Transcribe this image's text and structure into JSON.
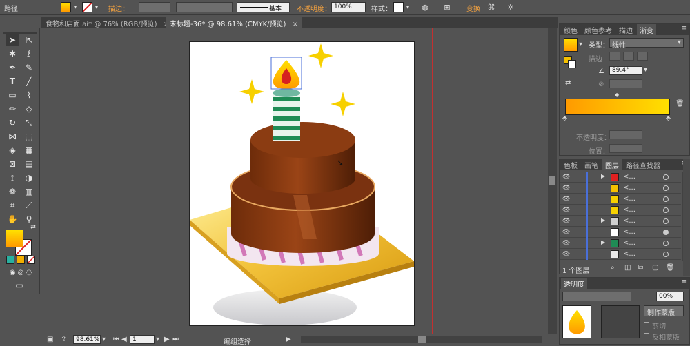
{
  "control_bar": {
    "object_type": "路径",
    "stroke_label": "描边：",
    "brush_label": "基本",
    "opacity_label": "不透明度：",
    "opacity_value": "100%",
    "style_label": "样式：",
    "transform_label": "变换"
  },
  "colors": {
    "fill_top": "#ffe000",
    "fill_bottom": "#ff9a00",
    "cake_dark": "#5a2408",
    "cake_mid": "#8b3c12",
    "plate": "#f2c23a",
    "guide": "#c23030",
    "layer_bar": "#4a6fd8"
  },
  "tabs": [
    {
      "label": "食物和店面.ai* @ 76% (RGB/预览)"
    },
    {
      "label": "未标题-36* @ 98.61% (CMYK/预览)"
    }
  ],
  "status_bar": {
    "zoom": "98.61%",
    "page": "1",
    "tool_status": "编组选择"
  },
  "gradient_panel": {
    "tabs": [
      "颜色",
      "颜色参考",
      "描边",
      "渐变"
    ],
    "type_label": "类型：",
    "type_value": "线性",
    "stroke_label": "描边",
    "angle_value": "89.4°",
    "opacity_label": "不透明度：",
    "position_label": "位置："
  },
  "layers_panel": {
    "tabs": [
      "色板",
      "画笔",
      "图层",
      "路径查找器"
    ],
    "rows": [
      {
        "name": "<...",
        "thumb": "#e02020",
        "expandable": true
      },
      {
        "name": "<...",
        "thumb": "#f5c000",
        "expandable": false
      },
      {
        "name": "<...",
        "thumb": "#f5d000",
        "expandable": false
      },
      {
        "name": "<...",
        "thumb": "#f5d000",
        "expandable": false
      },
      {
        "name": "<...",
        "thumb": "#cfcfcf",
        "expandable": true
      },
      {
        "name": "<...",
        "thumb": "#ffffff",
        "expandable": false
      },
      {
        "name": "<...",
        "thumb": "#1f8c55",
        "expandable": true
      },
      {
        "name": "<...",
        "thumb": "#e9e9e9",
        "expandable": false
      }
    ],
    "footer": "1 个图层"
  },
  "transparency_panel": {
    "title": "透明度",
    "opacity_value": "00%",
    "make_mask_button": "制作蒙版",
    "clip_label": "剪切",
    "invert_label": "反相蒙版"
  }
}
